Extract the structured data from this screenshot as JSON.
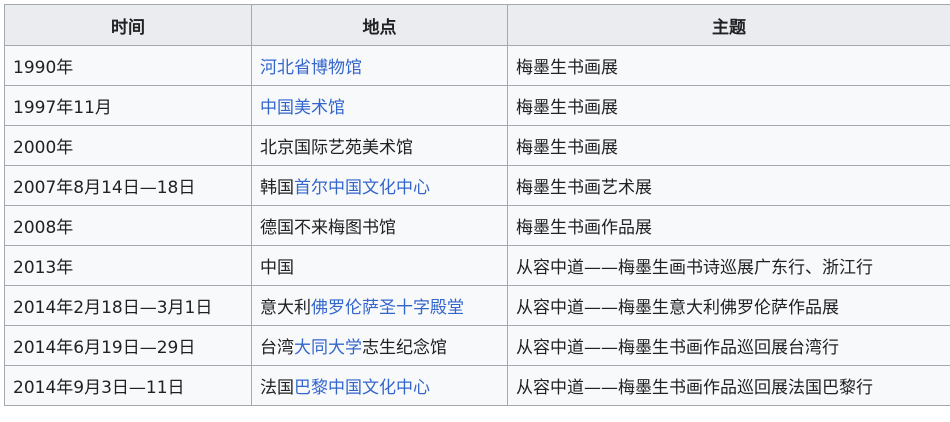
{
  "headers": [
    "时间",
    "地点",
    "主题"
  ],
  "rows": [
    {
      "time": "1990年",
      "place": [
        {
          "text": "河北省博物馆",
          "link": true
        }
      ],
      "theme": "梅墨生书画展"
    },
    {
      "time": "1997年11月",
      "place": [
        {
          "text": "中国美术馆",
          "link": true
        }
      ],
      "theme": "梅墨生书画展"
    },
    {
      "time": "2000年",
      "place": [
        {
          "text": "北京国际艺苑美术馆",
          "link": false
        }
      ],
      "theme": "梅墨生书画展"
    },
    {
      "time": "2007年8月14日—18日",
      "place": [
        {
          "text": "韩国",
          "link": false
        },
        {
          "text": "首尔中国文化中心",
          "link": true
        }
      ],
      "theme": "梅墨生书画艺术展"
    },
    {
      "time": "2008年",
      "place": [
        {
          "text": "德国不来梅图书馆",
          "link": false
        }
      ],
      "theme": "梅墨生书画作品展"
    },
    {
      "time": "2013年",
      "place": [
        {
          "text": "中国",
          "link": false
        }
      ],
      "theme": "从容中道——梅墨生画书诗巡展广东行、浙江行"
    },
    {
      "time": "2014年2月18日—3月1日",
      "place": [
        {
          "text": "意大利",
          "link": false
        },
        {
          "text": "佛罗伦萨圣十字殿堂",
          "link": true
        }
      ],
      "theme": "从容中道——梅墨生意大利佛罗伦萨作品展"
    },
    {
      "time": "2014年6月19日—29日",
      "place": [
        {
          "text": "台湾",
          "link": false
        },
        {
          "text": "大同大学",
          "link": true
        },
        {
          "text": "志生纪念馆",
          "link": false
        }
      ],
      "theme": "从容中道——梅墨生书画作品巡回展台湾行"
    },
    {
      "time": "2014年9月3日—11日",
      "place": [
        {
          "text": "法国",
          "link": false
        },
        {
          "text": "巴黎中国文化中心",
          "link": true
        }
      ],
      "theme": "从容中道——梅墨生书画作品巡回展法国巴黎行"
    }
  ]
}
